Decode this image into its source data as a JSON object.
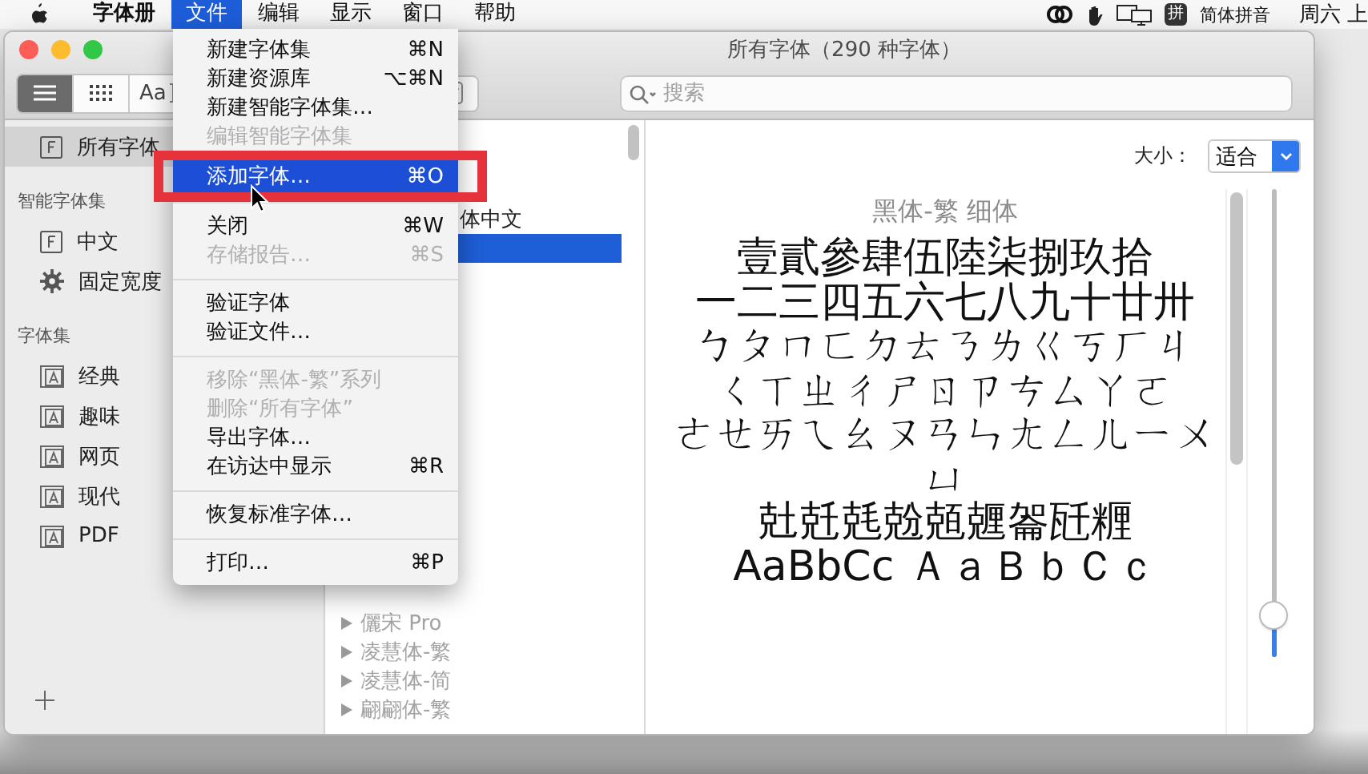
{
  "menubar": {
    "menus": [
      {
        "kind": "app",
        "label": "字体册",
        "selected": false
      },
      {
        "kind": "menu",
        "label": "文件",
        "selected": true
      },
      {
        "kind": "menu",
        "label": "编辑",
        "selected": false
      },
      {
        "kind": "menu",
        "label": "显示",
        "selected": false
      },
      {
        "kind": "menu",
        "label": "窗口",
        "selected": false
      },
      {
        "kind": "menu",
        "label": "帮助",
        "selected": false
      }
    ],
    "status": {
      "input_badge": "拼",
      "input_name": "简体拼音",
      "clock": "周六 上"
    }
  },
  "file_menu": {
    "items": [
      {
        "kind": "item",
        "label": "新建字体集",
        "shortcut": "⌘N",
        "disabled": false,
        "selected": false
      },
      {
        "kind": "item",
        "label": "新建资源库",
        "shortcut": "⌥⌘N",
        "disabled": false,
        "selected": false
      },
      {
        "kind": "item",
        "label": "新建智能字体集…",
        "disabled": false,
        "selected": false
      },
      {
        "kind": "item",
        "label": "编辑智能字体集",
        "disabled": true,
        "selected": false
      },
      {
        "kind": "item",
        "label": "添加字体…",
        "shortcut": "⌘O",
        "disabled": false,
        "selected": true
      },
      {
        "kind": "separator"
      },
      {
        "kind": "item",
        "label": "关闭",
        "shortcut": "⌘W",
        "disabled": false,
        "selected": false
      },
      {
        "kind": "item",
        "label": "存储报告…",
        "shortcut": "⌘S",
        "disabled": true,
        "selected": false
      },
      {
        "kind": "separator"
      },
      {
        "kind": "item",
        "label": "验证字体",
        "disabled": false,
        "selected": false
      },
      {
        "kind": "item",
        "label": "验证文件…",
        "disabled": false,
        "selected": false
      },
      {
        "kind": "separator"
      },
      {
        "kind": "item",
        "label": "移除“黑体-繁”系列",
        "disabled": true,
        "selected": false
      },
      {
        "kind": "item",
        "label": "删除“所有字体”",
        "disabled": true,
        "selected": false
      },
      {
        "kind": "item",
        "label": "导出字体…",
        "disabled": false,
        "selected": false
      },
      {
        "kind": "item",
        "label": "在访达中显示",
        "shortcut": "⌘R",
        "disabled": false,
        "selected": false
      },
      {
        "kind": "separator"
      },
      {
        "kind": "item",
        "label": "恢复标准字体…",
        "disabled": false,
        "selected": false
      },
      {
        "kind": "separator"
      },
      {
        "kind": "item",
        "label": "打印…",
        "shortcut": "⌘P",
        "disabled": false,
        "selected": false
      }
    ]
  },
  "window": {
    "title": "所有字体（290 种字体）"
  },
  "toolbar": {
    "view_modes": [
      {
        "kind": "list",
        "selected": true
      },
      {
        "kind": "grid",
        "selected": false
      },
      {
        "kind": "sample",
        "label": "Aa",
        "selected": false
      }
    ],
    "search": {
      "placeholder": "搜索"
    }
  },
  "sidebar": {
    "items": [
      {
        "kind": "font",
        "label": "所有字体",
        "selected": true
      },
      {
        "kind": "header",
        "label": "智能字体集"
      },
      {
        "kind": "font",
        "label": "中文",
        "selected": false
      },
      {
        "kind": "gear",
        "label": "固定宽度",
        "selected": false
      },
      {
        "kind": "header",
        "label": "字体集"
      },
      {
        "kind": "collection",
        "label": "经典",
        "selected": false
      },
      {
        "kind": "collection",
        "label": "趣味",
        "selected": false
      },
      {
        "kind": "collection",
        "label": "网页",
        "selected": false
      },
      {
        "kind": "collection",
        "label": "现代",
        "selected": false
      },
      {
        "kind": "collection",
        "label": "PDF",
        "selected": false
      }
    ]
  },
  "font_list": {
    "rows": [
      {
        "kind": "covered",
        "label": "体中文",
        "selected": false
      },
      {
        "kind": "covered",
        "selected": true
      },
      {
        "kind": "family",
        "label": "儷宋 Pro",
        "selected": false
      },
      {
        "kind": "family",
        "label": "凌慧体-繁",
        "selected": false
      },
      {
        "kind": "family",
        "label": "凌慧体-简",
        "selected": false
      },
      {
        "kind": "family",
        "label": "翩翩体-繁",
        "selected": false
      }
    ]
  },
  "preview": {
    "size_label": "大小：",
    "size_value": "适合",
    "sample_title": "黑体-繁 细体",
    "sample_lines": [
      "壹貳參肆伍陸柒捌玖拾",
      "一二三四五六七八九十廿卅",
      "ㄅㄆㄇㄈㄉㄊㄋㄌㄍㄎㄏㄐ",
      "ㄑㄒㄓㄔㄕㄖㄗㄘㄙㄚㄛ",
      "ㄜㄝㄞㄟㄠㄡㄢㄣㄤㄥㄦㄧㄨ",
      "ㄩ",
      "兙兛兞兝兡兣嗧瓩糎",
      "AaBbCc ＡａＢｂＣｃ"
    ],
    "size_slider": {
      "level": 0.09
    }
  }
}
